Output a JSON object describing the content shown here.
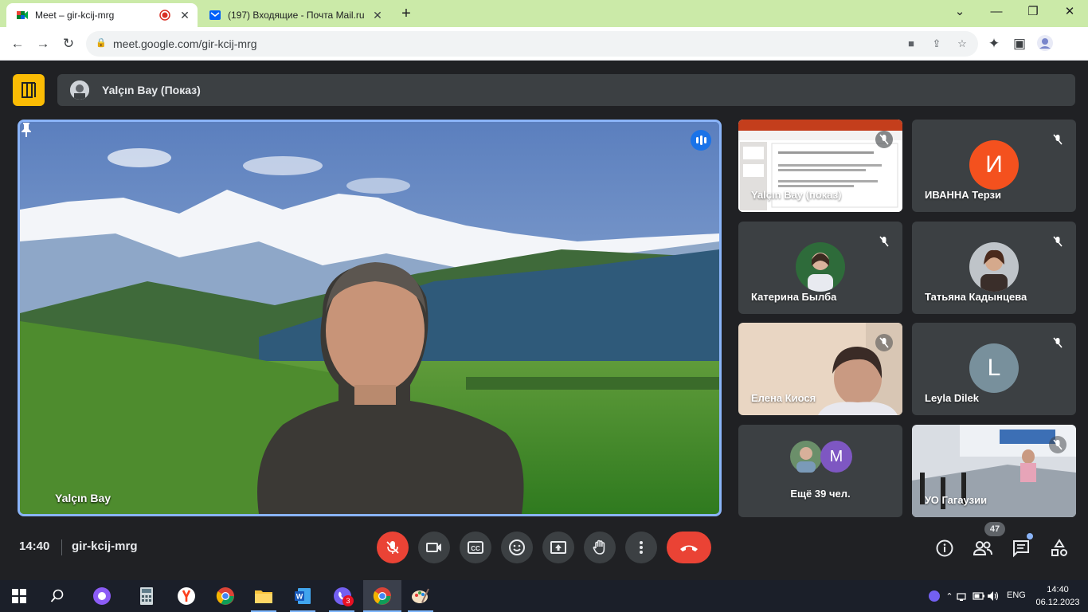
{
  "browser": {
    "tabs": [
      {
        "title": "Meet – gir-kcij-mrg",
        "active": true
      },
      {
        "title": "(197) Входящие - Почта Mail.ru",
        "active": false
      }
    ],
    "url": "meet.google.com/gir-kcij-mrg"
  },
  "meet": {
    "presenting_label": "Yalçın Bay (Показ)",
    "main_speaker": "Yalçın Bay",
    "tiles": [
      {
        "name": "Yalçın Bay (показ)"
      },
      {
        "name": "ИВАННА Терзи",
        "initial": "И"
      },
      {
        "name": "Катерина Былба"
      },
      {
        "name": "Татьяна Кадынцева"
      },
      {
        "name": "Елена Киося"
      },
      {
        "name": "Leyla Dilek",
        "initial": "L"
      },
      {
        "name": "Ещё 39 чел.",
        "initial": "M"
      },
      {
        "name": "УО Гагаузии"
      }
    ],
    "time": "14:40",
    "meeting_code": "gir-kcij-mrg",
    "participants_count": "47"
  },
  "taskbar": {
    "viber_badge": "3",
    "language": "ENG",
    "clock_time": "14:40",
    "clock_date": "06.12.2023"
  },
  "colors": {
    "tab_strip": "#cbeaa8",
    "meet_bg": "#202124",
    "tile_bg": "#3c4043",
    "end_call": "#ea4335",
    "accent": "#8ab4f8"
  }
}
